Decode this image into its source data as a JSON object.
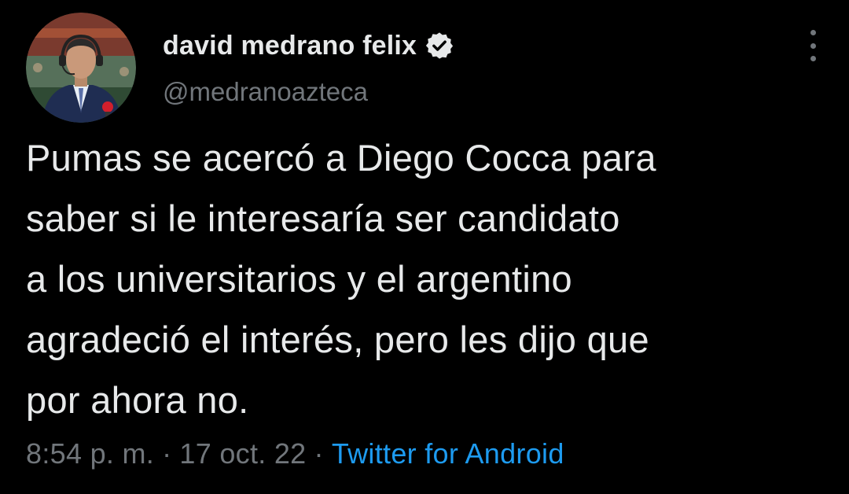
{
  "user": {
    "display_name": "david medrano felix",
    "handle": "@medranoazteca",
    "verified": true
  },
  "tweet": {
    "text_lines": [
      "Pumas se acercó a Diego Cocca para",
      "saber si le interesaría ser candidato",
      "a los universitarios y el argentino",
      "agradeció el interés, pero les dijo que",
      "por ahora no."
    ],
    "time": "8:54 p. m.",
    "separator": "·",
    "date": "17 oct. 22",
    "source": "Twitter for Android"
  },
  "icons": {
    "avatar": "profile-photo",
    "verified": "verified-badge-icon",
    "more": "more-options-icon"
  },
  "colors": {
    "background": "#000000",
    "primary_text": "#e7e9ea",
    "secondary_text": "#71767b",
    "link": "#1d9bf0"
  }
}
